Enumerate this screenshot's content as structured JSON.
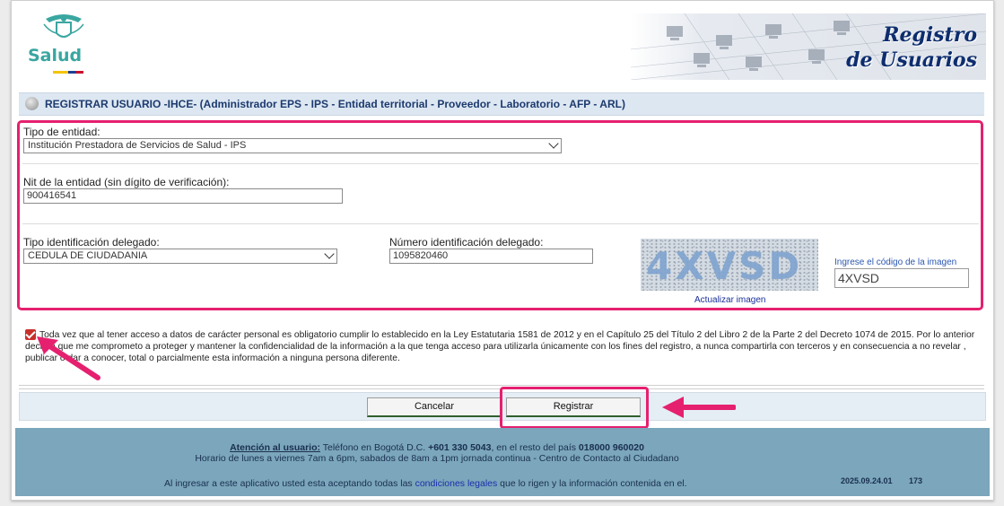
{
  "header": {
    "logo_text": "Salud",
    "banner_line1": "Registro",
    "banner_line2": "de Usuarios"
  },
  "title_bar": {
    "text": "REGISTRAR USUARIO -IHCE- (Administrador EPS - IPS - Entidad territorial - Proveedor - Laboratorio - AFP - ARL)"
  },
  "form": {
    "entity_type_label": "Tipo de entidad:",
    "entity_type_value": "Institución Prestadora de Servicios de Salud - IPS",
    "nit_label": "Nit de la entidad (sin dígito de verificación):",
    "nit_value": "900416541",
    "id_type_label": "Tipo identificación delegado:",
    "id_type_value": "CEDULA DE CIUDADANIA",
    "id_number_label": "Número identificación delegado:",
    "id_number_value": "1095820460",
    "captcha_code": "4XVSD",
    "refresh_captcha_label": "Actualizar imagen",
    "captcha_prompt": "Ingrese el código de la imagen",
    "captcha_input_value": "4XVSD"
  },
  "consent": {
    "checked": true,
    "text": "Toda vez que al tener acceso a datos de carácter personal es obligatorio cumplir lo establecido en la Ley Estatutaria 1581 de 2012 y en el Capítulo 25 del Título 2 del Libro 2 de la Parte 2 del Decreto 1074 de 2015. Por lo anterior declaro que me comprometo a proteger y mantener la confidencialidad de la información a la que tenga acceso para utilizarla únicamente con los fines del registro, a nunca compartirla con terceros y en consecuencia a no revelar , publicar o dar a conocer, total o parcialmente esta información a ninguna persona diferente."
  },
  "buttons": {
    "cancel": "Cancelar",
    "register": "Registrar"
  },
  "footer": {
    "attention_label": "Atención al usuario:",
    "contact_text": " Teléfono en Bogotá D.C. ",
    "phone_bogota": "+601 330 5043",
    "contact_text2": ", en el resto del país ",
    "phone_national": "018000 960020",
    "schedule": "Horario de lunes a viernes 7am a 6pm, sabados de 8am a 1pm jornada continua - Centro de Contacto al Ciudadano",
    "legal_prefix": "Al ingresar a este aplicativo usted esta aceptando todas las ",
    "legal_link": "condiciones legales",
    "legal_suffix": " que lo  rigen y la información contenida en el.",
    "version": "2025.09.24.01",
    "number": "173"
  },
  "colors": {
    "highlight": "#e5206f",
    "footer_bg": "#7ba6bb",
    "title_bar_bg": "#dde7f2",
    "title_text": "#1c3a6e"
  }
}
